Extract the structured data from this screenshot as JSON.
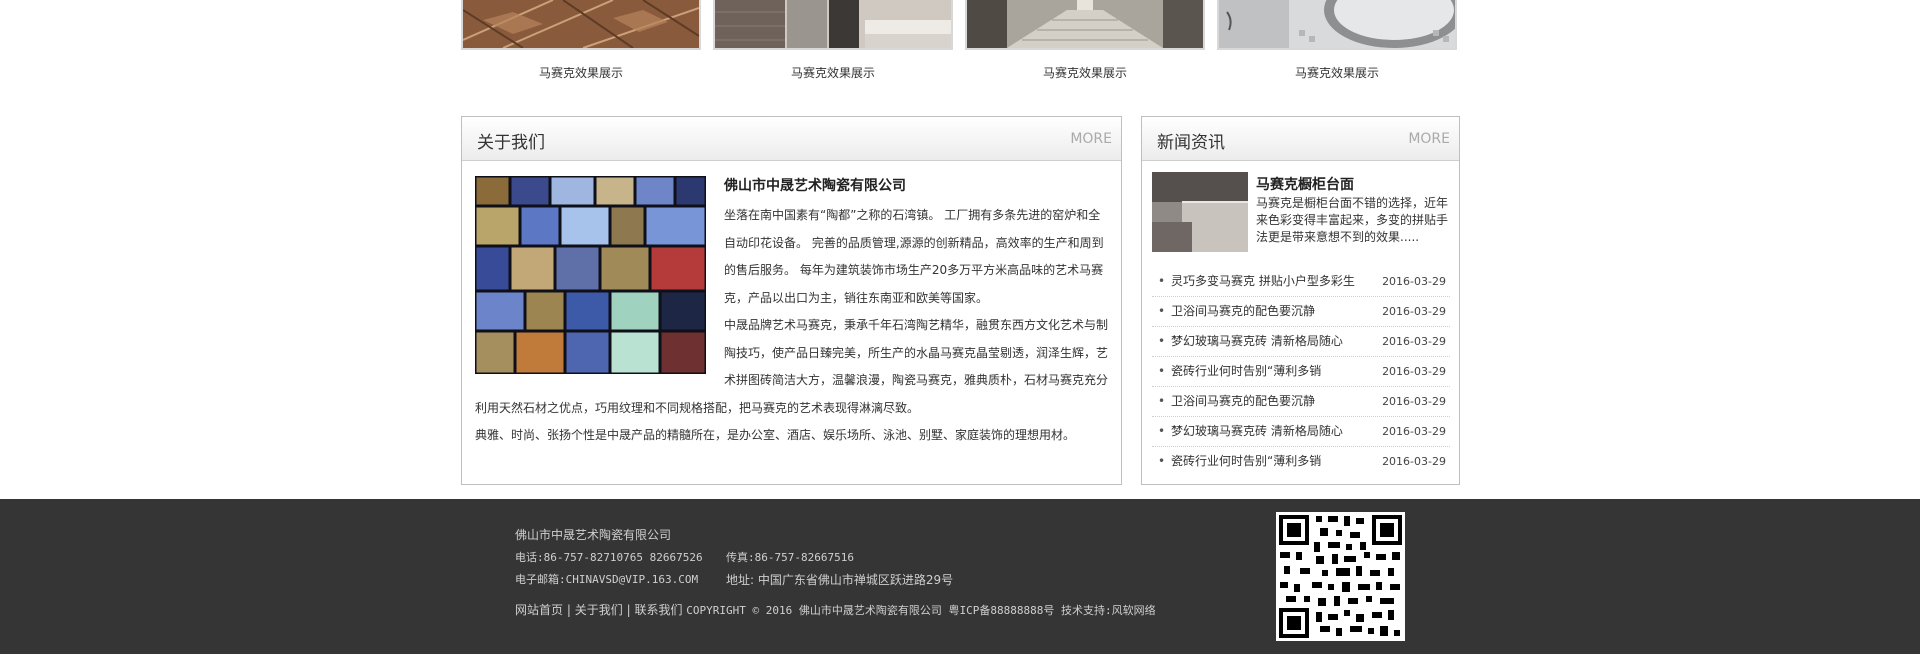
{
  "gallery": {
    "items": [
      {
        "caption": "马赛克效果展示"
      },
      {
        "caption": "马赛克效果展示"
      },
      {
        "caption": "马赛克效果展示"
      },
      {
        "caption": "马赛克效果展示"
      }
    ]
  },
  "about": {
    "title": "关于我们",
    "more": "MORE",
    "company": "佛山市中晟艺术陶瓷有限公司",
    "paragraphs": [
      "坐落在南中国素有“陶都”之称的石湾镇。 工厂拥有多条先进的窑炉和全自动印花设备。 完善的品质管理,源源的创新精品，高效率的生产和周到的售后服务。 每年为建筑装饰市场生产20多万平方米高品味的艺术马赛克，产品以出口为主，销往东南亚和欧美等国家。",
      "中晟品牌艺术马赛克，秉承千年石湾陶艺精华，融贯东西方文化艺术与制陶技巧，使产品日臻完美，所生产的水晶马赛克晶莹剔透，润泽生辉，艺术拼图砖简洁大方，温馨浪漫，陶瓷马赛克，雅典质朴，石材马赛克充分利用天然石材之优点，巧用纹理和不同规格搭配，把马赛克的艺术表现得淋漓尽致。",
      "典雅、时尚、张扬个性是中晟产品的精髓所在，是办公室、酒店、娱乐场所、泳池、别墅、家庭装饰的理想用材。"
    ]
  },
  "news": {
    "title": "新闻资讯",
    "more": "MORE",
    "top": {
      "title": "马赛克橱柜台面",
      "desc": "马赛克是橱柜台面不错的选择，近年来色彩变得丰富起来，多变的拼贴手法更是带来意想不到的效果....."
    },
    "items": [
      {
        "title": "灵巧多变马赛克 拼贴小户型多彩生",
        "date": "2016-03-29"
      },
      {
        "title": "卫浴间马赛克的配色要沉静",
        "date": "2016-03-29"
      },
      {
        "title": "梦幻玻璃马赛克砖 清新格局随心",
        "date": "2016-03-29"
      },
      {
        "title": "瓷砖行业何时告别“薄利多销",
        "date": "2016-03-29"
      },
      {
        "title": "卫浴间马赛克的配色要沉静",
        "date": "2016-03-29"
      },
      {
        "title": "梦幻玻璃马赛克砖 清新格局随心",
        "date": "2016-03-29"
      },
      {
        "title": "瓷砖行业何时告别“薄利多销",
        "date": "2016-03-29"
      }
    ]
  },
  "footer": {
    "company": "佛山市中晟艺术陶瓷有限公司",
    "phone": "电话:86-757-82710765  82667526",
    "fax": "传真:86-757-82667516",
    "email": "电子邮箱:CHINAVSD@VIP.163.COM",
    "address": "地址: 中国广东省佛山市禅城区跃进路29号",
    "links": [
      "网站首页",
      "关于我们",
      "联系我们"
    ],
    "separator": "|",
    "copyright": "COPYRIGHT © 2016 佛山市中晟艺术陶瓷有限公司 粤ICP备88888888号 技术支持:风软网络"
  },
  "colors": {
    "footer_bg": "#353535",
    "panel_border": "#bfbfbf",
    "more_text": "#aaaaaa"
  }
}
